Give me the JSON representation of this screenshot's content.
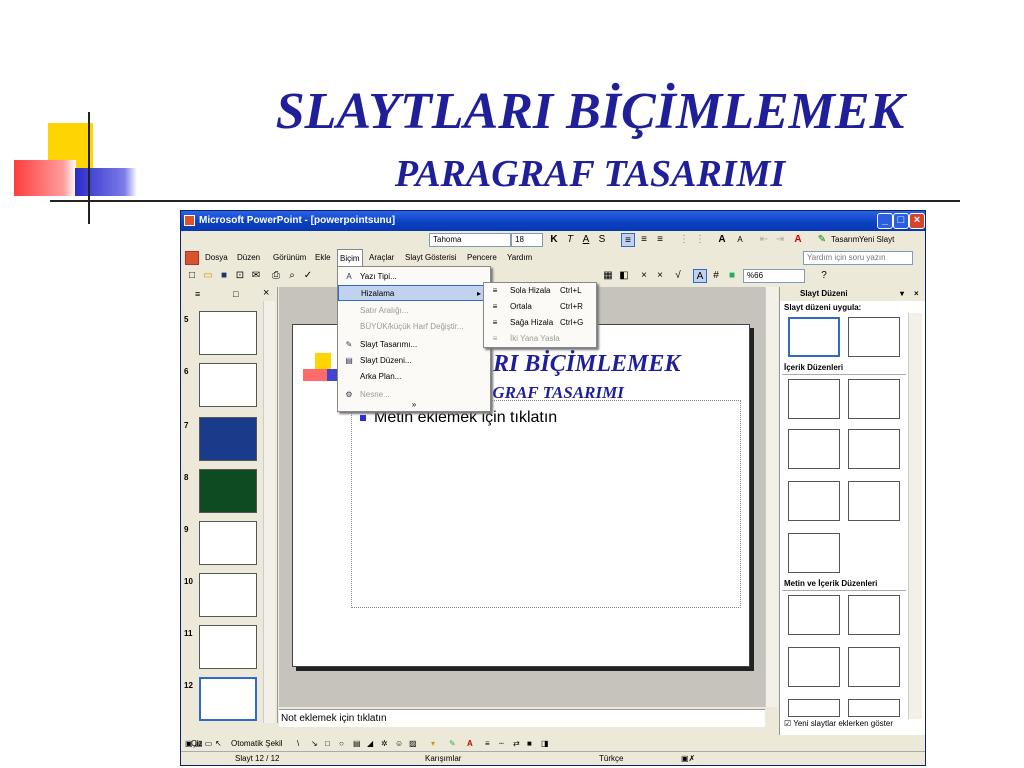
{
  "slide": {
    "title_main": "SLAYTLARI BİÇİMLEMEK",
    "title_sub": "PARAGRAF TASARIMI"
  },
  "window": {
    "title": "Microsoft PowerPoint - [powerpointsunu]",
    "menu": [
      "Dosya",
      "Düzen",
      "Görünüm",
      "Ekle",
      "Biçim",
      "Araçlar",
      "Slayt Gösterisi",
      "Pencere",
      "Yardım"
    ],
    "help_placeholder": "Yardım için soru yazın",
    "font_name": "Tahoma",
    "font_size": "18",
    "zoom": "%66",
    "design_label": "Tasarım",
    "new_slide_label": "Yeni Slayt"
  },
  "format_menu": {
    "items": [
      {
        "label": "Yazı Tipi...",
        "enabled": true
      },
      {
        "label": "Hizalama",
        "enabled": true
      },
      {
        "label": "Satır Aralığı...",
        "enabled": false
      },
      {
        "label": "BÜYÜK/küçük Harf Değiştir...",
        "enabled": false
      },
      {
        "label": "Slayt Tasarımı...",
        "enabled": true
      },
      {
        "label": "Slayt Düzeni...",
        "enabled": true
      },
      {
        "label": "Arka Plan...",
        "enabled": true
      },
      {
        "label": "Nesne...",
        "enabled": false
      }
    ],
    "more": "»"
  },
  "align_submenu": {
    "items": [
      {
        "label": "Sola Hizala",
        "shortcut": "Ctrl+L",
        "enabled": true
      },
      {
        "label": "Ortala",
        "shortcut": "Ctrl+R",
        "enabled": true
      },
      {
        "label": "Sağa Hizala",
        "shortcut": "Ctrl+G",
        "enabled": true
      },
      {
        "label": "İki Yana Yasla",
        "shortcut": "",
        "enabled": false
      }
    ]
  },
  "thumbnails": [
    "5",
    "6",
    "7",
    "8",
    "9",
    "10",
    "11",
    "12"
  ],
  "edit_slide": {
    "title_fragment_1": "ARI BİÇİMLEMEK",
    "title_fragment_2": "AGRAF TASARIMI",
    "body_placeholder": "Metin eklemek için tıklatın"
  },
  "notes_placeholder": "Not eklemek için tıklatın",
  "task_pane": {
    "title": "Slayt Düzeni",
    "apply_label": "Slayt düzeni uygula:",
    "sections": [
      "İçerik Düzenleri",
      "Metin ve İçerik Düzenleri"
    ],
    "checkbox_label": "Yeni slaytlar eklerken göster"
  },
  "draw_bar": {
    "draw_label": "Çiz",
    "autoshapes_label": "Otomatik Şekil"
  },
  "status": {
    "slide": "Slayt 12 / 12",
    "design": "Karışımlar",
    "language": "Türkçe"
  },
  "colors": {
    "title_blue": "#1f1f99",
    "deco_yellow": "#ffd700",
    "deco_red": "#ff4b4b",
    "deco_blue": "#3333cc"
  }
}
